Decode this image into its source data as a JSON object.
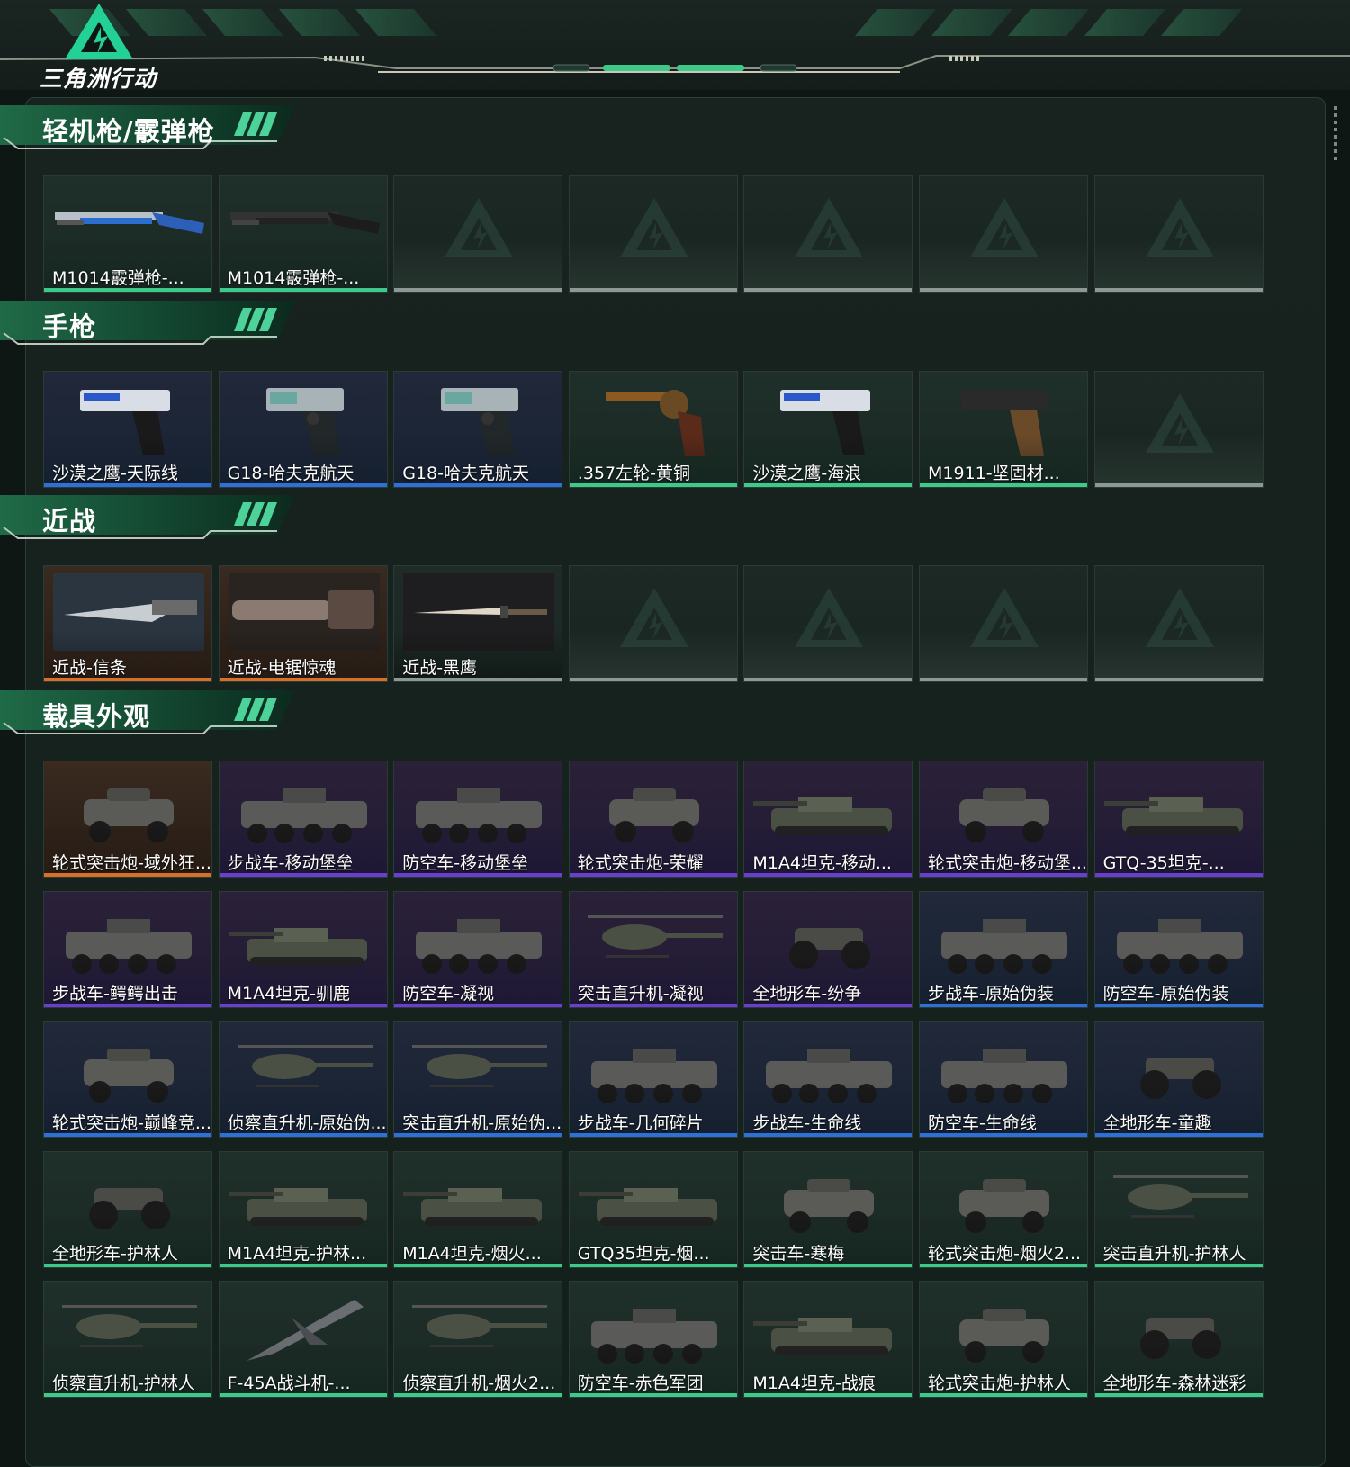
{
  "app": {
    "logo_text": "三角洲行动"
  },
  "colors": {
    "accent": "#3cc98a",
    "rarity_green": "#3cc98a",
    "rarity_blue": "#2f6fd8",
    "rarity_purple": "#6a3fd0",
    "rarity_orange": "#d9702a",
    "empty_slot": "#8c9894"
  },
  "sections": [
    {
      "title": "轻机枪/霰弹枪",
      "items": [
        {
          "label": "M1014霰弹枪-...",
          "rarity": "green",
          "icon": "shotgun-blue-icon"
        },
        {
          "label": "M1014霰弹枪-...",
          "rarity": "green",
          "icon": "shotgun-black-icon"
        },
        {
          "label": "",
          "rarity": "empty"
        },
        {
          "label": "",
          "rarity": "empty"
        },
        {
          "label": "",
          "rarity": "empty"
        },
        {
          "label": "",
          "rarity": "empty"
        },
        {
          "label": "",
          "rarity": "empty"
        }
      ]
    },
    {
      "title": "手枪",
      "items": [
        {
          "label": "沙漠之鹰-天际线",
          "rarity": "blue",
          "icon": "desert-eagle-icon"
        },
        {
          "label": "G18-哈夫克航天",
          "rarity": "blue",
          "icon": "glock-icon"
        },
        {
          "label": "G18-哈夫克航天",
          "rarity": "blue",
          "icon": "glock-icon"
        },
        {
          "label": ".357左轮-黄铜",
          "rarity": "green",
          "icon": "revolver-icon"
        },
        {
          "label": "沙漠之鹰-海浪",
          "rarity": "green",
          "icon": "desert-eagle-icon"
        },
        {
          "label": "M1911-坚固材...",
          "rarity": "green",
          "icon": "pistol-1911-icon"
        },
        {
          "label": "",
          "rarity": "empty"
        }
      ]
    },
    {
      "title": "近战",
      "items": [
        {
          "label": "近战-信条",
          "rarity": "orange",
          "icon": "knife-icon"
        },
        {
          "label": "近战-电锯惊魂",
          "rarity": "orange",
          "icon": "chainsaw-icon"
        },
        {
          "label": "近战-黑鹰",
          "rarity": "empty",
          "icon": "dagger-icon"
        },
        {
          "label": "",
          "rarity": "empty"
        },
        {
          "label": "",
          "rarity": "empty"
        },
        {
          "label": "",
          "rarity": "empty"
        },
        {
          "label": "",
          "rarity": "empty"
        }
      ]
    },
    {
      "title": "载具外观",
      "items": [
        {
          "label": "轮式突击炮-域外狂...",
          "rarity": "orange",
          "icon": "armored-car-icon"
        },
        {
          "label": "步战车-移动堡垒",
          "rarity": "purple",
          "icon": "ifv-icon"
        },
        {
          "label": "防空车-移动堡垒",
          "rarity": "purple",
          "icon": "ifv-icon"
        },
        {
          "label": "轮式突击炮-荣耀",
          "rarity": "purple",
          "icon": "armored-car-icon"
        },
        {
          "label": "M1A4坦克-移动...",
          "rarity": "purple",
          "icon": "tank-icon"
        },
        {
          "label": "轮式突击炮-移动堡...",
          "rarity": "purple",
          "icon": "armored-car-icon"
        },
        {
          "label": "GTQ-35坦克-...",
          "rarity": "purple",
          "icon": "tank-icon"
        },
        {
          "label": "步战车-鳄鳄出击",
          "rarity": "purple",
          "icon": "ifv-icon"
        },
        {
          "label": "M1A4坦克-驯鹿",
          "rarity": "purple",
          "icon": "tank-icon"
        },
        {
          "label": "防空车-凝视",
          "rarity": "purple",
          "icon": "ifv-icon"
        },
        {
          "label": "突击直升机-凝视",
          "rarity": "purple",
          "icon": "helicopter-icon"
        },
        {
          "label": "全地形车-纷争",
          "rarity": "purple",
          "icon": "atv-icon"
        },
        {
          "label": "步战车-原始伪装",
          "rarity": "blue",
          "icon": "ifv-icon"
        },
        {
          "label": "防空车-原始伪装",
          "rarity": "blue",
          "icon": "ifv-icon"
        },
        {
          "label": "轮式突击炮-巅峰竞...",
          "rarity": "blue",
          "icon": "armored-car-icon"
        },
        {
          "label": "侦察直升机-原始伪...",
          "rarity": "blue",
          "icon": "helicopter-icon"
        },
        {
          "label": "突击直升机-原始伪...",
          "rarity": "blue",
          "icon": "helicopter-icon"
        },
        {
          "label": "步战车-几何碎片",
          "rarity": "blue",
          "icon": "ifv-icon"
        },
        {
          "label": "步战车-生命线",
          "rarity": "blue",
          "icon": "ifv-icon"
        },
        {
          "label": "防空车-生命线",
          "rarity": "blue",
          "icon": "ifv-icon"
        },
        {
          "label": "全地形车-童趣",
          "rarity": "blue",
          "icon": "atv-icon"
        },
        {
          "label": "全地形车-护林人",
          "rarity": "green",
          "icon": "atv-icon"
        },
        {
          "label": "M1A4坦克-护林...",
          "rarity": "green",
          "icon": "tank-icon"
        },
        {
          "label": "M1A4坦克-烟火...",
          "rarity": "green",
          "icon": "tank-icon"
        },
        {
          "label": "GTQ35坦克-烟...",
          "rarity": "green",
          "icon": "tank-icon"
        },
        {
          "label": "突击车-寒梅",
          "rarity": "green",
          "icon": "armored-car-icon"
        },
        {
          "label": "轮式突击炮-烟火2...",
          "rarity": "green",
          "icon": "armored-car-icon"
        },
        {
          "label": "突击直升机-护林人",
          "rarity": "green",
          "icon": "helicopter-icon"
        },
        {
          "label": "侦察直升机-护林人",
          "rarity": "green",
          "icon": "helicopter-icon"
        },
        {
          "label": "F-45A战斗机-...",
          "rarity": "green",
          "icon": "jet-icon"
        },
        {
          "label": "侦察直升机-烟火2...",
          "rarity": "green",
          "icon": "helicopter-icon"
        },
        {
          "label": "防空车-赤色军团",
          "rarity": "green",
          "icon": "ifv-icon"
        },
        {
          "label": "M1A4坦克-战痕",
          "rarity": "green",
          "icon": "tank-icon"
        },
        {
          "label": "轮式突击炮-护林人",
          "rarity": "green",
          "icon": "armored-car-icon"
        },
        {
          "label": "全地形车-森林迷彩",
          "rarity": "green",
          "icon": "atv-icon"
        }
      ]
    }
  ]
}
